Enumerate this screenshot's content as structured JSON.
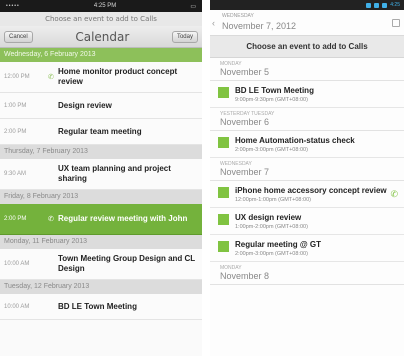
{
  "left": {
    "status": {
      "time": "4:25 PM",
      "signal": "•••••"
    },
    "prompt": "Choose an event to add to Calls",
    "nav": {
      "cancel": "Cancel",
      "title": "Calendar",
      "today": "Today"
    },
    "rows": [
      {
        "kind": "day",
        "style": "green",
        "label": "Wednesday, 6 February 2013"
      },
      {
        "kind": "event",
        "time": "12:00 PM",
        "phone": true,
        "title": "Home monitor product concept review"
      },
      {
        "kind": "event",
        "time": "1:00 PM",
        "phone": false,
        "title": "Design review"
      },
      {
        "kind": "event",
        "time": "2:00 PM",
        "phone": false,
        "title": "Regular team meeting"
      },
      {
        "kind": "day",
        "style": "grey",
        "label": "Thursday, 7 February 2013"
      },
      {
        "kind": "event",
        "time": "9:30 AM",
        "phone": false,
        "title": "UX team planning and project sharing"
      },
      {
        "kind": "day",
        "style": "grey",
        "label": "Friday, 8 February 2013"
      },
      {
        "kind": "event",
        "time": "2:00 PM",
        "phone": true,
        "title": "Regular review meeting with John",
        "selected": true
      },
      {
        "kind": "day",
        "style": "grey",
        "label": "Monday, 11 February 2013"
      },
      {
        "kind": "event",
        "time": "10:00 AM",
        "phone": false,
        "title": "Town Meeting Group Design and CL Design"
      },
      {
        "kind": "day",
        "style": "grey",
        "label": "Tuesday, 12 February 2013"
      },
      {
        "kind": "event",
        "time": "10:00 AM",
        "phone": false,
        "title": "BD LE Town Meeting"
      }
    ]
  },
  "right": {
    "status": {
      "time": "4:25"
    },
    "header": {
      "weekday": "WEDNESDAY",
      "date": "November 7, 2012"
    },
    "prompt": "Choose an event to add to Calls",
    "items": [
      {
        "kind": "day",
        "weekday": "MONDAY",
        "date": "November 5"
      },
      {
        "kind": "event",
        "title": "BD LE Town Meeting",
        "sub": "9:00pm-9:30pm (GMT+08:00)",
        "phone": false
      },
      {
        "kind": "day",
        "weekday": "YESTERDAY TUESDAY",
        "date": "November 6"
      },
      {
        "kind": "event",
        "title": "Home Automation-status check",
        "sub": "2:00pm-3:00pm (GMT+08:00)",
        "phone": false
      },
      {
        "kind": "day",
        "weekday": "WEDNESDAY",
        "date": "November 7"
      },
      {
        "kind": "event",
        "title": "iPhone home accessory concept review",
        "sub": "12:00pm-1:00pm (GMT+08:00)",
        "phone": true
      },
      {
        "kind": "event",
        "title": "UX design review",
        "sub": "1:00pm-2:00pm (GMT+08:00)",
        "phone": false
      },
      {
        "kind": "event",
        "title": "Regular meeting @ GT",
        "sub": "2:00pm-3:00pm (GMT+08:00)",
        "phone": false
      },
      {
        "kind": "day",
        "weekday": "MONDAY",
        "date": "November 8"
      }
    ]
  }
}
